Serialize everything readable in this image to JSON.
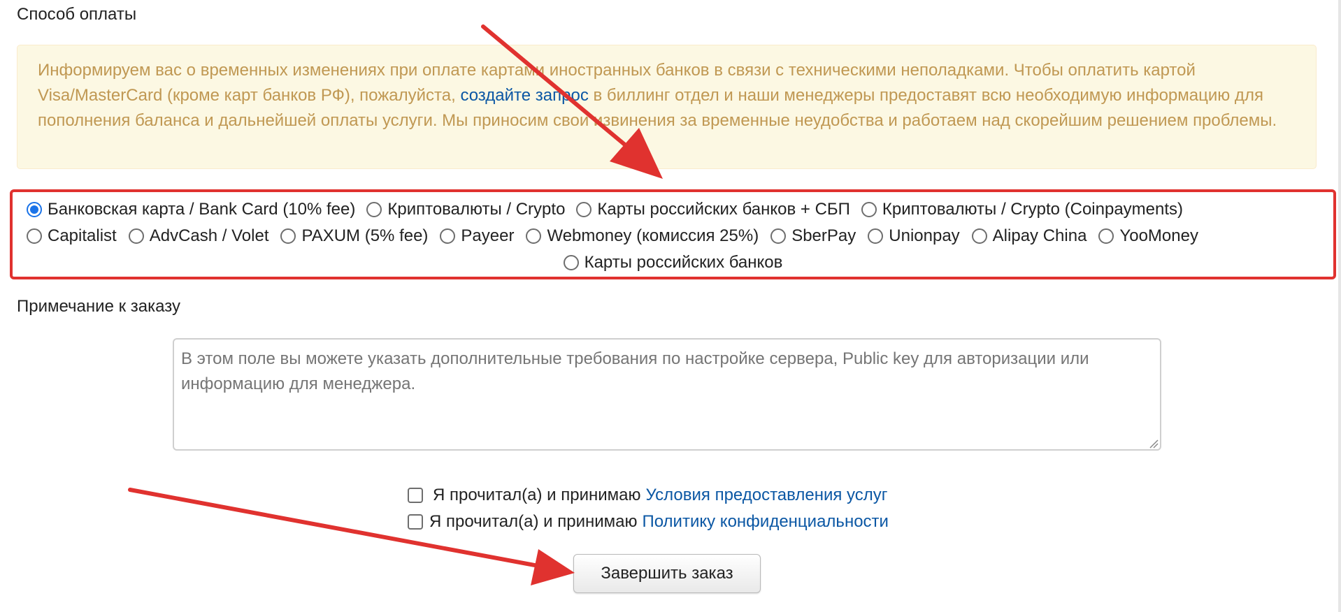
{
  "payment": {
    "title": "Способ оплаты",
    "notice": {
      "text_before": "Информируем вас о временных изменениях при оплате картами иностранных банков в связи с техническими неполадками. Чтобы оплатить картой Visa/MasterCard (кроме карт банков РФ), пожалуйста, ",
      "link": "создайте запрос",
      "text_after": " в биллинг отдел и наши менеджеры предоставят всю необходимую информацию для пополнения баланса и дальнейшей оплаты услуги. Мы приносим свои извинения за временные неудобства и работаем над скорейшим решением проблемы."
    },
    "methods": [
      {
        "label": "Банковская карта / Bank Card (10% fee)",
        "selected": true
      },
      {
        "label": "Криптовалюты / Crypto",
        "selected": false
      },
      {
        "label": "Карты российских банков + СБП",
        "selected": false
      },
      {
        "label": "Криптовалюты / Crypto (Coinpayments)",
        "selected": false
      },
      {
        "label": "Capitalist",
        "selected": false
      },
      {
        "label": "AdvCash / Volet",
        "selected": false
      },
      {
        "label": "PAXUM (5% fee)",
        "selected": false
      },
      {
        "label": "Payeer",
        "selected": false
      },
      {
        "label": "Webmoney (комиссия 25%)",
        "selected": false
      },
      {
        "label": "SberPay",
        "selected": false
      },
      {
        "label": "Unionpay",
        "selected": false
      },
      {
        "label": "Alipay China",
        "selected": false
      },
      {
        "label": "YooMoney",
        "selected": false
      },
      {
        "label": "Карты российских банков",
        "selected": false
      }
    ]
  },
  "note": {
    "title": "Примечание к заказу",
    "placeholder": "В этом поле вы можете указать дополнительные требования по настройке сервера, Public key для авторизации или информацию для менеджера.",
    "value": ""
  },
  "agreements": {
    "terms_text": "Я прочитал(а) и принимаю",
    "terms_link": "Условия предоставления услуг",
    "privacy_text": "Я прочитал(а) и принимаю",
    "privacy_link": "Политику конфиденциальности"
  },
  "submit": {
    "label": "Завершить заказ"
  },
  "colors": {
    "annotation_red": "#e0322f",
    "link_blue": "#0b57a4",
    "alert_text": "#c09853",
    "alert_bg": "#fcf8e3",
    "radio_selected": "#1a73e8"
  }
}
